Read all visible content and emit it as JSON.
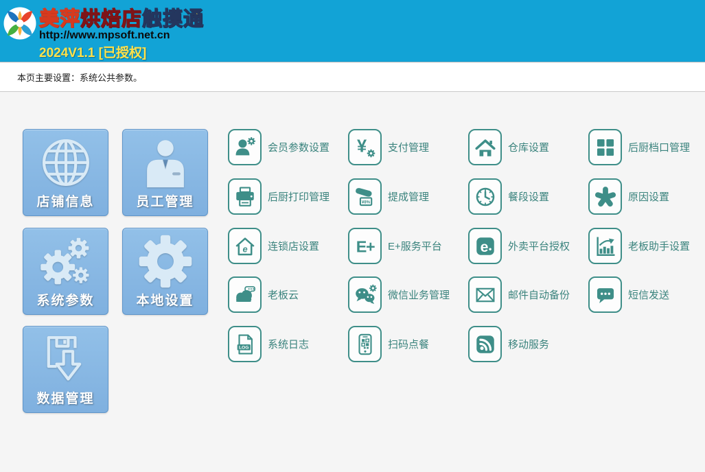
{
  "header": {
    "title_part1": "美萍",
    "title_part2": "烘焙店",
    "title_part3": "触摸通",
    "url": "http://www.mpsoft.net.cn",
    "version": "2024V1.1 [已授权]"
  },
  "info_bar": {
    "text": "本页主要设置：系统公共参数。"
  },
  "colors": {
    "header_blue": "#12a3d6",
    "tile_teal": "#3e8e88",
    "big_button_blue": "#7fb0df",
    "title_yellow": "#f7dc3e",
    "title_red": "#c1272d",
    "page_background": "#f5f5f5"
  },
  "big_buttons": [
    {
      "name": "store-info-button",
      "label": "店铺信息",
      "icon": "globe-icon"
    },
    {
      "name": "employee-mgmt-button",
      "label": "员工管理",
      "icon": "employee-icon"
    },
    {
      "name": "system-params-button",
      "label": "系统参数",
      "icon": "gears-icon"
    },
    {
      "name": "local-settings-button",
      "label": "本地设置",
      "icon": "gear-icon"
    },
    {
      "name": "data-mgmt-button",
      "label": "数据管理",
      "icon": "save-disk-arrow-icon"
    }
  ],
  "tiles": [
    {
      "name": "member-params-tile",
      "label": "会员参数设置",
      "icon": "member-settings-icon"
    },
    {
      "name": "payment-mgmt-tile",
      "label": "支付管理",
      "icon": "payment-icon"
    },
    {
      "name": "warehouse-tile",
      "label": "仓库设置",
      "icon": "warehouse-icon"
    },
    {
      "name": "kitchen-station-tile",
      "label": "后厨档口管理",
      "icon": "kitchen-station-icon"
    },
    {
      "name": "kitchen-print-tile",
      "label": "后厨打印管理",
      "icon": "kitchen-printer-icon"
    },
    {
      "name": "commission-tile",
      "label": "提成管理",
      "icon": "commission-icon"
    },
    {
      "name": "meal-period-tile",
      "label": "餐段设置",
      "icon": "meal-period-clock-icon"
    },
    {
      "name": "reason-tile",
      "label": "原因设置",
      "icon": "reason-asterisk-icon"
    },
    {
      "name": "chain-store-tile",
      "label": "连锁店设置",
      "icon": "chain-store-icon"
    },
    {
      "name": "eplus-platform-tile",
      "label": "E+服务平台",
      "icon": "eplus-icon"
    },
    {
      "name": "takeout-auth-tile",
      "label": "外卖平台授权",
      "icon": "takeout-platform-icon"
    },
    {
      "name": "boss-assistant-tile",
      "label": "老板助手设置",
      "icon": "boss-assistant-chart-icon"
    },
    {
      "name": "boss-cloud-tile",
      "label": "老板云",
      "icon": "boss-cloud-icon"
    },
    {
      "name": "wechat-business-tile",
      "label": "微信业务管理",
      "icon": "wechat-icon"
    },
    {
      "name": "email-backup-tile",
      "label": "邮件自动备份",
      "icon": "email-backup-icon"
    },
    {
      "name": "sms-send-tile",
      "label": "短信发送",
      "icon": "sms-icon"
    },
    {
      "name": "system-log-tile",
      "label": "系统日志",
      "icon": "system-log-icon"
    },
    {
      "name": "qr-ordering-tile",
      "label": "扫码点餐",
      "icon": "qr-ordering-icon"
    },
    {
      "name": "mobile-service-tile",
      "label": "移动服务",
      "icon": "mobile-service-icon"
    }
  ]
}
